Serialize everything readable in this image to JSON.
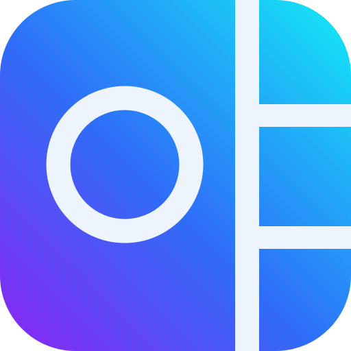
{
  "icon": {
    "name": "collage-layout-app-icon",
    "colors": {
      "gradient_top_right": "#12ECF6",
      "gradient_mid": "#2F6CF8",
      "gradient_bottom_left": "#8C25F4",
      "stroke": "#EEF4FD",
      "background": "#FFFFFF"
    }
  }
}
